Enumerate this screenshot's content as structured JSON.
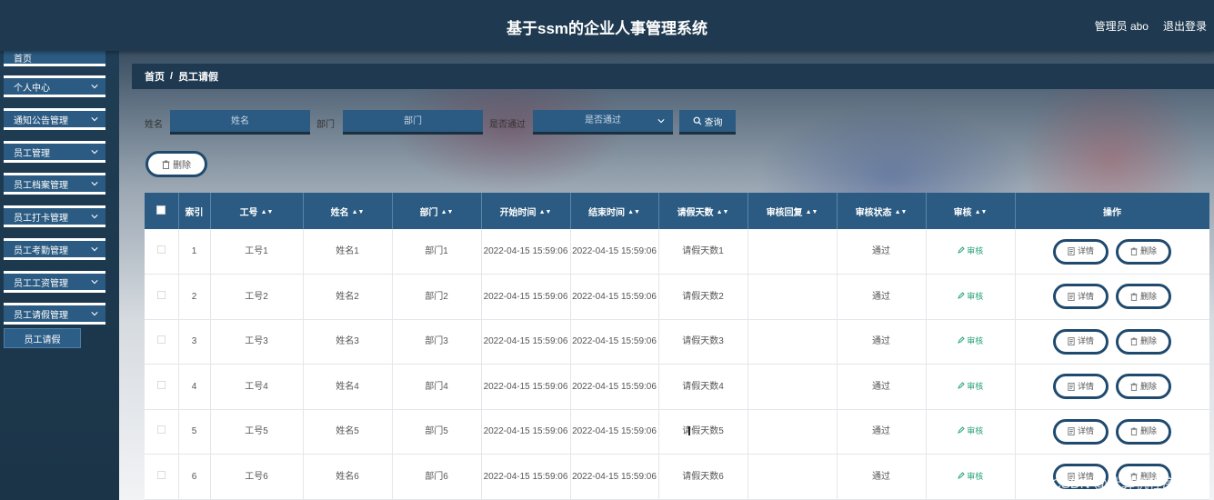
{
  "header": {
    "title": "基于ssm的企业人事管理系统",
    "user": "管理员 abo",
    "logout": "退出登录"
  },
  "sidebar": {
    "items": [
      {
        "label": "首页"
      },
      {
        "label": "个人中心"
      },
      {
        "label": "通知公告管理"
      },
      {
        "label": "员工管理"
      },
      {
        "label": "员工档案管理"
      },
      {
        "label": "员工打卡管理"
      },
      {
        "label": "员工考勤管理"
      },
      {
        "label": "员工工资管理"
      },
      {
        "label": "员工请假管理"
      }
    ],
    "sub_item": "员工请假"
  },
  "breadcrumb": {
    "home": "首页",
    "sep": "/",
    "current": "员工请假"
  },
  "search": {
    "name_label": "姓名",
    "name_placeholder": "姓名",
    "dept_label": "部门",
    "dept_placeholder": "部门",
    "pass_label": "是否通过",
    "pass_placeholder": "是否通过",
    "query_button": "查询"
  },
  "toolbar": {
    "delete_label": "删除"
  },
  "table": {
    "headers": {
      "index": "索引",
      "emp_no": "工号",
      "name": "姓名",
      "dept": "部门",
      "start": "开始时间",
      "end": "结束时间",
      "days": "请假天数",
      "reply": "审核回复",
      "status": "审核状态",
      "audit": "审核",
      "ops": "操作"
    },
    "rows": [
      {
        "index": "1",
        "emp_no": "工号1",
        "name": "姓名1",
        "dept": "部门1",
        "start": "2022-04-15 15:59:06",
        "end": "2022-04-15 15:59:06",
        "days": "请假天数1",
        "reply": "",
        "status": "通过",
        "audit": "审核"
      },
      {
        "index": "2",
        "emp_no": "工号2",
        "name": "姓名2",
        "dept": "部门2",
        "start": "2022-04-15 15:59:06",
        "end": "2022-04-15 15:59:06",
        "days": "请假天数2",
        "reply": "",
        "status": "通过",
        "audit": "审核"
      },
      {
        "index": "3",
        "emp_no": "工号3",
        "name": "姓名3",
        "dept": "部门3",
        "start": "2022-04-15 15:59:06",
        "end": "2022-04-15 15:59:06",
        "days": "请假天数3",
        "reply": "",
        "status": "通过",
        "audit": "审核"
      },
      {
        "index": "4",
        "emp_no": "工号4",
        "name": "姓名4",
        "dept": "部门4",
        "start": "2022-04-15 15:59:06",
        "end": "2022-04-15 15:59:06",
        "days": "请假天数4",
        "reply": "",
        "status": "通过",
        "audit": "审核"
      },
      {
        "index": "5",
        "emp_no": "工号5",
        "name": "姓名5",
        "dept": "部门5",
        "start": "2022-04-15 15:59:06",
        "end": "2022-04-15 15:59:06",
        "days": "请假天数5",
        "reply": "",
        "status": "通过",
        "audit": "审核"
      },
      {
        "index": "6",
        "emp_no": "工号6",
        "name": "姓名6",
        "dept": "部门6",
        "start": "2022-04-15 15:59:06",
        "end": "2022-04-15 15:59:06",
        "days": "请假天数6",
        "reply": "",
        "status": "通过",
        "audit": "审核"
      }
    ],
    "detail_label": "详情",
    "delete_label": "删除"
  },
  "watermark": "CSDN @计算机程序设计",
  "colors": {
    "header_bg": "#1f3a50",
    "accent": "#2b5b82",
    "audit_green": "#2aa37a"
  }
}
